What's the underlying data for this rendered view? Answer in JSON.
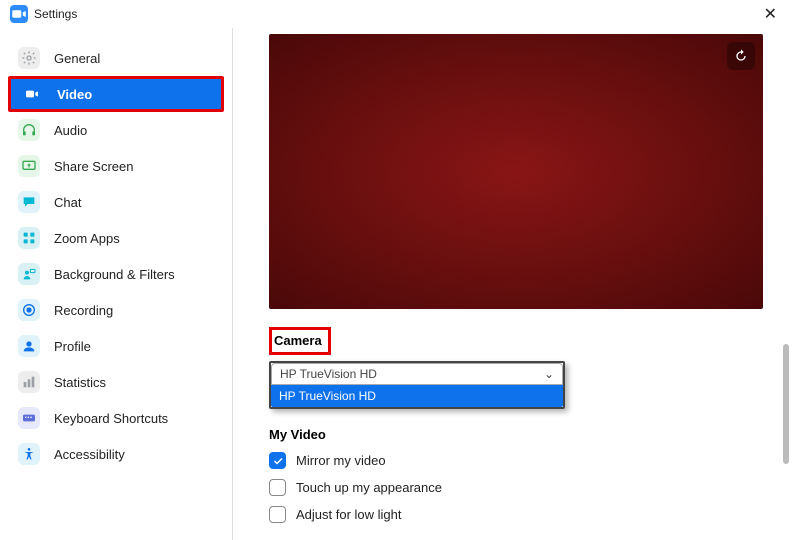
{
  "window": {
    "title": "Settings"
  },
  "sidebar": {
    "items": [
      {
        "label": "General"
      },
      {
        "label": "Video"
      },
      {
        "label": "Audio"
      },
      {
        "label": "Share Screen"
      },
      {
        "label": "Chat"
      },
      {
        "label": "Zoom Apps"
      },
      {
        "label": "Background & Filters"
      },
      {
        "label": "Recording"
      },
      {
        "label": "Profile"
      },
      {
        "label": "Statistics"
      },
      {
        "label": "Keyboard Shortcuts"
      },
      {
        "label": "Accessibility"
      }
    ],
    "active_index": 1
  },
  "camera": {
    "section_label": "Camera",
    "selected": "HP TrueVision HD",
    "dropdown_option": "HP TrueVision HD"
  },
  "my_video": {
    "section_label": "My Video",
    "options": [
      {
        "label": "Mirror my video",
        "checked": true
      },
      {
        "label": "Touch up my appearance",
        "checked": false
      },
      {
        "label": "Adjust for low light",
        "checked": false
      }
    ]
  },
  "colors": {
    "accent": "#0e72ed",
    "highlight_border": "#e40000"
  }
}
